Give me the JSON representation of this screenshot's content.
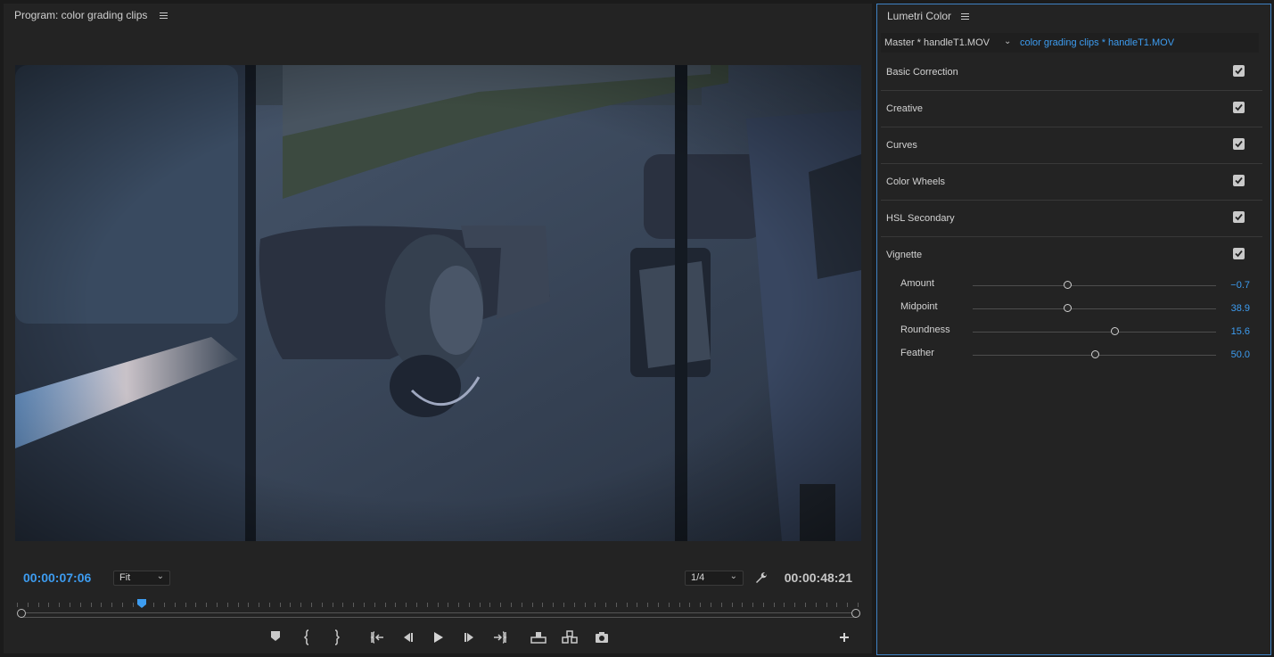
{
  "program": {
    "title": "Program: color grading clips",
    "current_time": "00:00:07:06",
    "duration": "00:00:48:21",
    "zoom_level": "Fit",
    "resolution": "1/4",
    "playhead_fraction": 0.148,
    "icons": [
      "menu-icon",
      "wrench-icon",
      "marker-icon",
      "mark-in-icon",
      "mark-out-icon",
      "go-to-in-icon",
      "step-back-icon",
      "play-icon",
      "step-forward-icon",
      "go-to-out-icon",
      "lift-icon",
      "extract-icon",
      "export-frame-icon",
      "add-button-icon"
    ]
  },
  "lumetri": {
    "title": "Lumetri Color",
    "master_clip": "Master * handleT1.MOV",
    "sequence_clip": "color grading clips * handleT1.MOV",
    "sections": [
      {
        "label": "Basic Correction",
        "checked": true
      },
      {
        "label": "Creative",
        "checked": true
      },
      {
        "label": "Curves",
        "checked": true
      },
      {
        "label": "Color Wheels",
        "checked": true
      },
      {
        "label": "HSL Secondary",
        "checked": true
      },
      {
        "label": "Vignette",
        "checked": true
      }
    ],
    "vignette": [
      {
        "label": "Amount",
        "value": "−0.7",
        "position": 0.39
      },
      {
        "label": "Midpoint",
        "value": "38.9",
        "position": 0.39
      },
      {
        "label": "Roundness",
        "value": "15.6",
        "position": 0.585
      },
      {
        "label": "Feather",
        "value": "50.0",
        "position": 0.505
      }
    ]
  },
  "colors": {
    "accent": "#3d9cf0",
    "panel_bg": "#232323",
    "panel_border": "#3f82c4"
  }
}
